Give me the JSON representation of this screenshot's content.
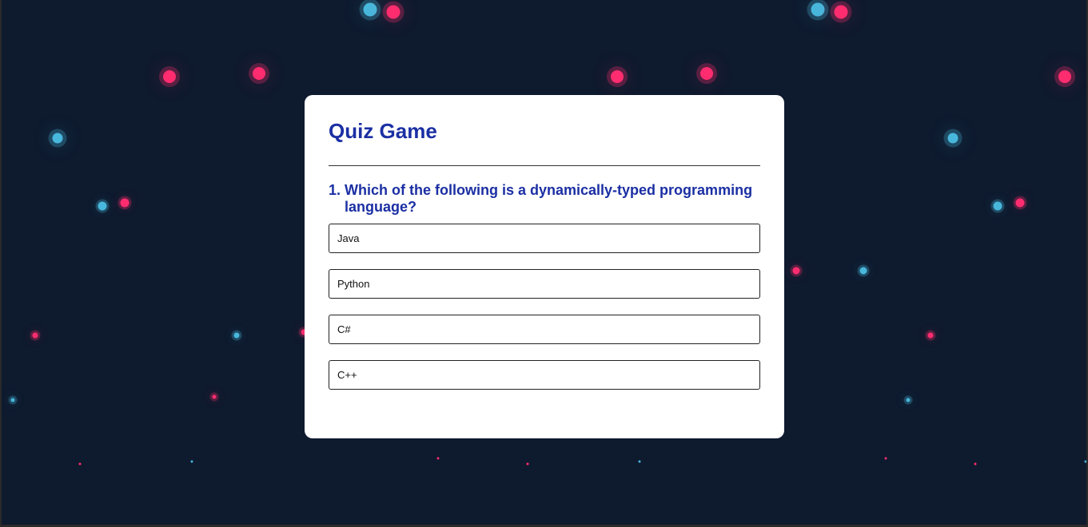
{
  "quiz": {
    "title": "Quiz Game",
    "question_number": "1.",
    "question_text": "Which of the following is a dynamically-typed programming language?",
    "options": [
      "Java",
      "Python",
      "C#",
      "C++"
    ]
  },
  "colors": {
    "background": "#0e1a2e",
    "accent_pink": "#ff2d6f",
    "accent_blue": "#48b7dc",
    "title_color": "#1b2fa3"
  }
}
